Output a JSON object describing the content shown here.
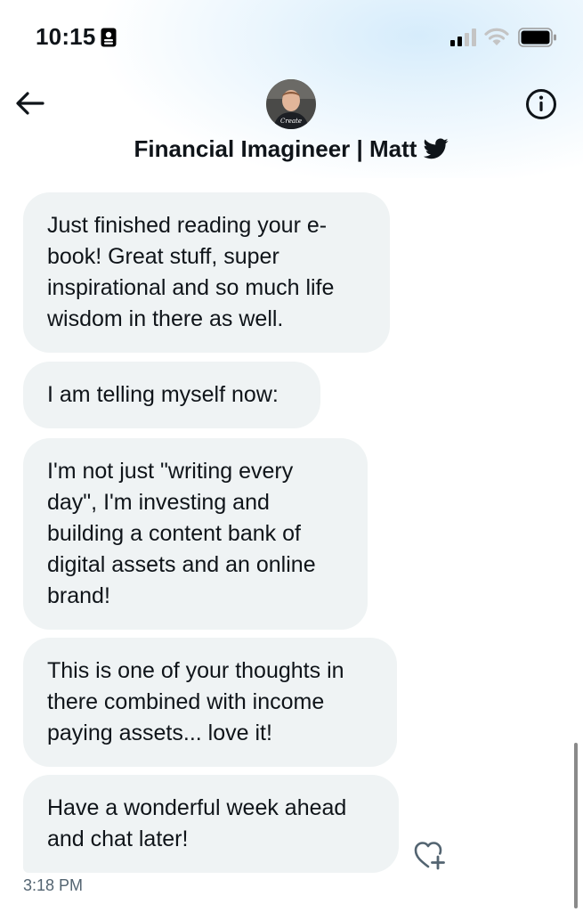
{
  "status_bar": {
    "time": "10:15",
    "icons": [
      "id-card-icon",
      "signal-icon",
      "wifi-icon",
      "battery-icon"
    ]
  },
  "header": {
    "back_icon": "arrow-left-icon",
    "info_icon": "info-icon",
    "title": "Financial Imagineer | Matt",
    "platform_icon": "twitter-bird-icon"
  },
  "messages": [
    {
      "lines": [
        "Just finished reading your e-",
        "book! Great stuff, super",
        "inspirational and so much life",
        "wisdom in there as well."
      ]
    },
    {
      "lines": [
        "I am telling myself now:"
      ]
    },
    {
      "lines": [
        "I'm not just \"writing every",
        "day\", I'm investing and",
        "building a content bank of",
        "digital assets and an online",
        "brand!"
      ]
    },
    {
      "lines": [
        "This is one of your thoughts in",
        "there combined with income",
        "paying assets... love it!"
      ]
    },
    {
      "lines": [
        "Have a wonderful week ahead",
        "and chat later!"
      ]
    }
  ],
  "timestamp": "3:18 PM",
  "react_icon": "heart-plus-icon",
  "colors": {
    "bubble": "#eff3f4",
    "text": "#0f1419",
    "timestamp": "#536471",
    "header_glow": "#d6ecfb"
  }
}
